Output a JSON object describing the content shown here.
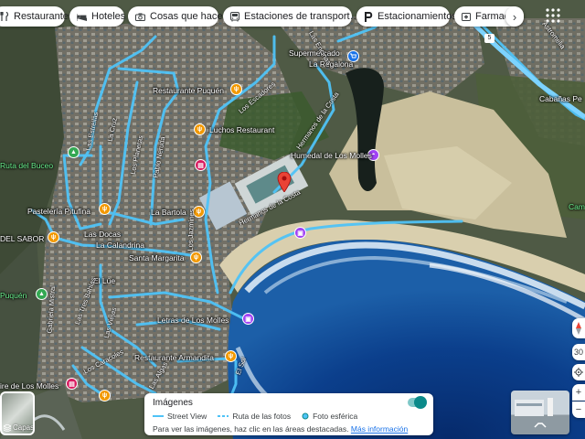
{
  "categories": [
    {
      "label": "Restaurantes",
      "icon": "fork-knife-icon"
    },
    {
      "label": "Hoteles",
      "icon": "bed-icon"
    },
    {
      "label": "Cosas que hacer",
      "icon": "camera-icon"
    },
    {
      "label": "Estaciones de transport…",
      "icon": "bus-icon"
    },
    {
      "label": "Estacionamientos",
      "icon": "parking-icon"
    },
    {
      "label": "Farmaci",
      "icon": "pharmacy-icon"
    }
  ],
  "place_labels": {
    "supermercado": "Supermercado",
    "la_regalona": "La Regalona",
    "restaurante_puquen": "Restaurante Puquén",
    "luchos": "Luchos Restaurant",
    "humedal": "Humedal de Los Molles",
    "pasteleria": "Pastelería Pitufina",
    "la_bartola": "La Bartola",
    "del_sabor": "DEL SABOR",
    "las_docas": "Las Docas",
    "la_calandrina": "La Calandrina",
    "santa_margarita": "Santa Margarita",
    "el_lue": "El Lúe",
    "letras": "Letras de Los Molles",
    "armandita": "Restaurante Armandita",
    "ire_molles": "ire de Los Molles",
    "ruta_del_buceo": "Ruta del Buceo",
    "puquen_left": "Puquén",
    "cabanas": "Cabañas Pe",
    "cam": "Cam"
  },
  "road_labels": {
    "las_encinas": "Las Encinas",
    "los_escadores": "Los Escadores",
    "hermanos_costa": "Hermanos de la Costa",
    "hermanos_costa_2": "Hermanos de la Costa",
    "astromelia": "Astromelia",
    "los_estrellas": "Las Estrellas",
    "los_planetas": "Los Planetas",
    "padre_neruda": "Pablo Neruda",
    "la_cruz": "La Cruz",
    "gabriela_mistral": "Gabriela Mistral",
    "las_tres": "Las Tres Bahías",
    "las_viejas": "Las Viejas",
    "los_jazmines": "Los Jazmines",
    "los_caracoles": "Los Caracoles",
    "las_algas": "Las Algas",
    "el_soh": "El Sol",
    "route_badge": "5"
  },
  "legend": {
    "title": "Imágenes",
    "street_view": "Street View",
    "ruta_fotos": "Ruta de las fotos",
    "foto_esferica": "Foto esférica",
    "hint": "Para ver las imágenes, haz clic en las áreas destacadas.",
    "link": "Más información"
  },
  "layers_label": "Capas",
  "scale_label": "30",
  "colors": {
    "street_view_line": "#4fc3f7",
    "marker_red": "#ea4335",
    "food_orange": "#f29900",
    "attraction_purple": "#a142f4",
    "shopping_blue": "#1a73e8",
    "park_green": "#34a853",
    "ocean": "#0d47a1"
  }
}
